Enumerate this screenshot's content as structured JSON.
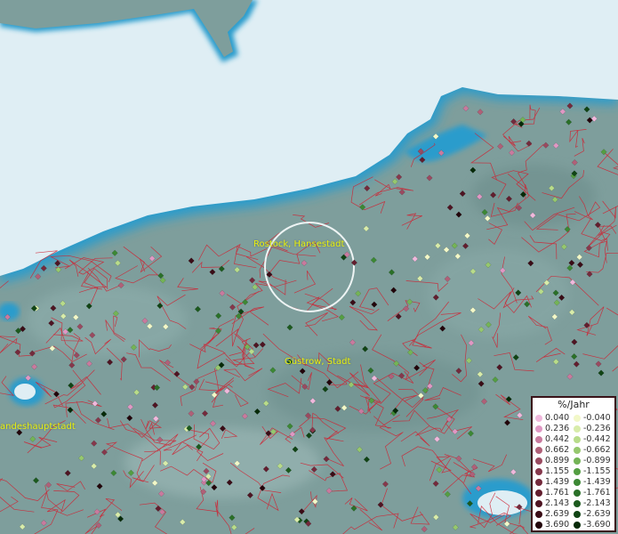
{
  "map": {
    "labels": {
      "rostock": "Rostock, Hansestadt",
      "guestrow": "Güstrow, Stadt",
      "schwerin": "andeshauptstadt"
    }
  },
  "legend": {
    "title": "%/Jahr",
    "positive": [
      {
        "value": "0.040",
        "color": "#f0b8dc"
      },
      {
        "value": "0.236",
        "color": "#e098c4"
      },
      {
        "value": "0.442",
        "color": "#c97a9e"
      },
      {
        "value": "0.662",
        "color": "#b06078"
      },
      {
        "value": "0.899",
        "color": "#9a4a60"
      },
      {
        "value": "1.155",
        "color": "#86384c"
      },
      {
        "value": "1.439",
        "color": "#742a3c"
      },
      {
        "value": "1.761",
        "color": "#621e2e"
      },
      {
        "value": "2.143",
        "color": "#4e1422"
      },
      {
        "value": "2.639",
        "color": "#3a0c16"
      },
      {
        "value": "3.690",
        "color": "#22040a"
      }
    ],
    "negative": [
      {
        "value": "-0.040",
        "color": "#f2f8c8"
      },
      {
        "value": "-0.236",
        "color": "#d8ecaa"
      },
      {
        "value": "-0.442",
        "color": "#b8dc8a"
      },
      {
        "value": "-0.662",
        "color": "#96c86e"
      },
      {
        "value": "-0.899",
        "color": "#74b456"
      },
      {
        "value": "-1.155",
        "color": "#549e42"
      },
      {
        "value": "-1.439",
        "color": "#3c8834"
      },
      {
        "value": "-1.761",
        "color": "#2a7028"
      },
      {
        "value": "-2.143",
        "color": "#1c5a1e"
      },
      {
        "value": "-2.639",
        "color": "#104414"
      },
      {
        "value": "-3.690",
        "color": "#062a08"
      }
    ]
  }
}
